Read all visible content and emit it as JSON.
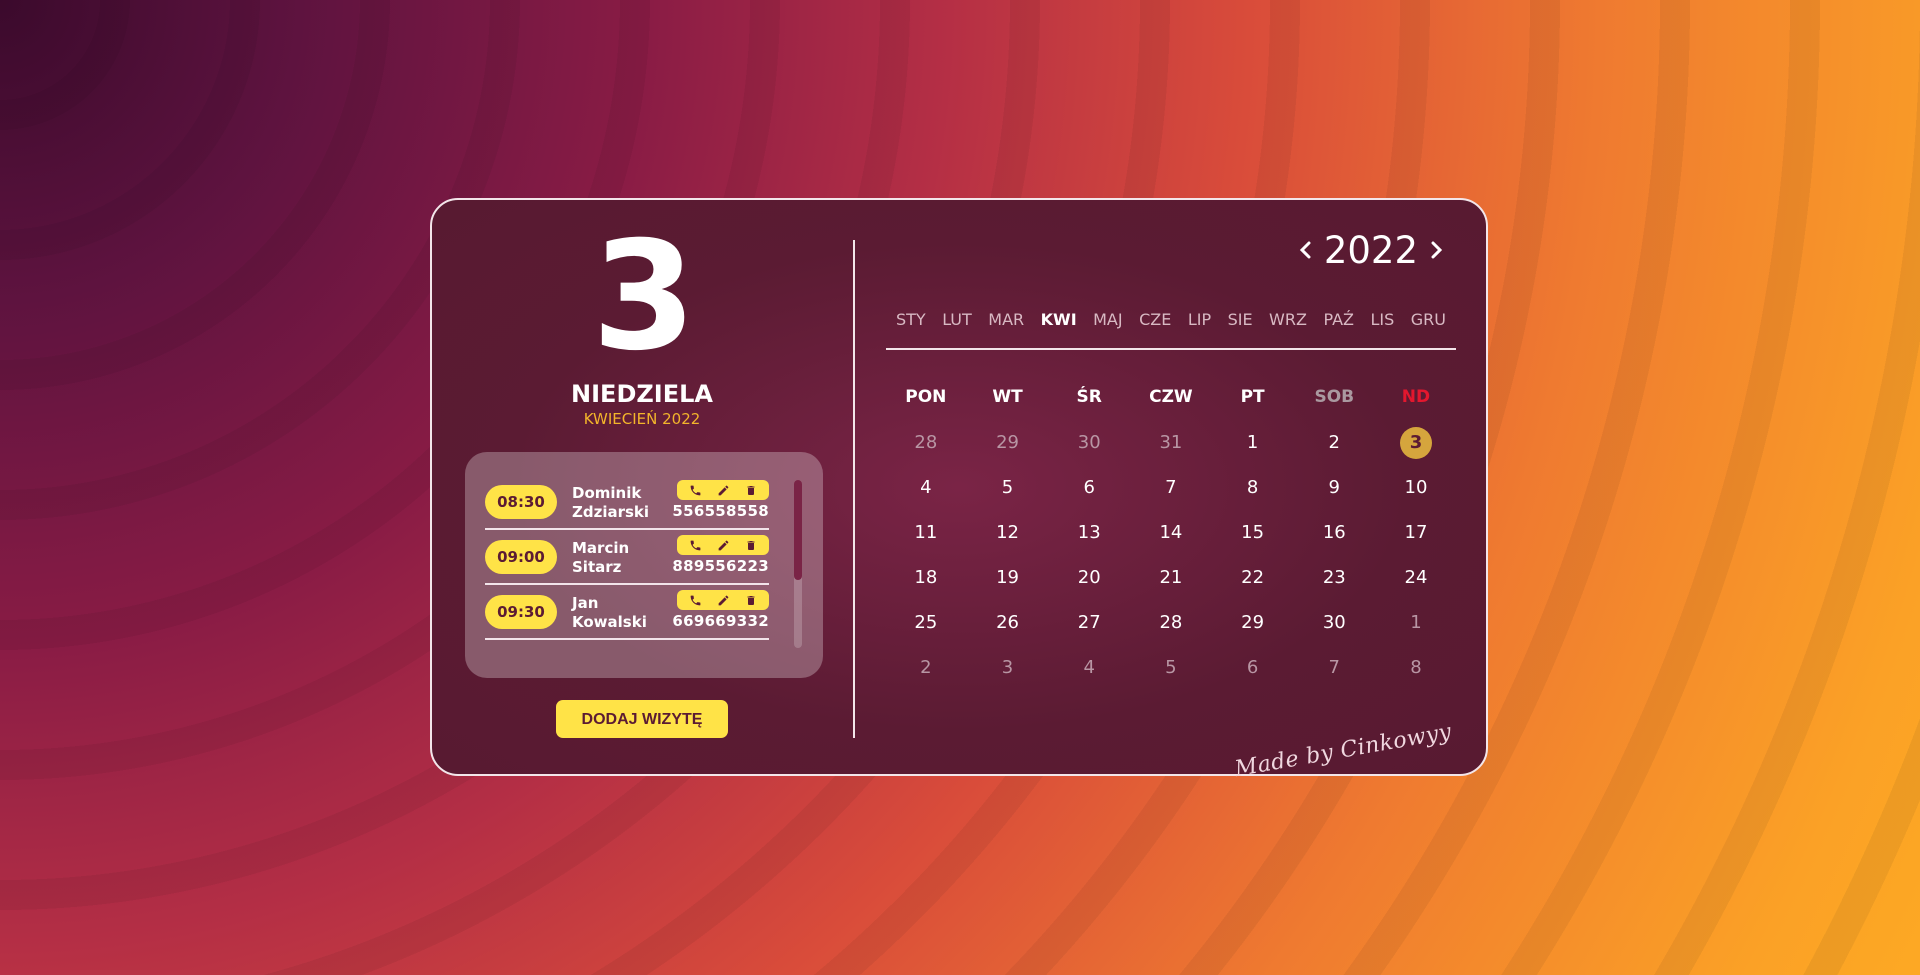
{
  "colors": {
    "accent_yellow": "#ffe347",
    "today_gold": "#d5a53d",
    "sunday_red": "#e3172e",
    "card_bg": "#5b1b33"
  },
  "day_panel": {
    "day_number": "3",
    "weekday": "NIEDZIELA",
    "month_year": "KWIECIEŃ 2022"
  },
  "appointments": [
    {
      "time": "08:30",
      "first_name": "Dominik",
      "last_name": "Zdziarski",
      "phone": "556558558"
    },
    {
      "time": "09:00",
      "first_name": "Marcin",
      "last_name": "Sitarz",
      "phone": "889556223"
    },
    {
      "time": "09:30",
      "first_name": "Jan",
      "last_name": "Kowalski",
      "phone": "669669332"
    }
  ],
  "appointment_icons": [
    "phone-icon",
    "edit-icon",
    "trash-icon"
  ],
  "add_button_label": "DODAJ WIZYTĘ",
  "year_nav": {
    "prev": "<",
    "year": "2022",
    "next": ">"
  },
  "months": [
    "STY",
    "LUT",
    "MAR",
    "KWI",
    "MAJ",
    "CZE",
    "LIP",
    "SIE",
    "WRZ",
    "PAŹ",
    "LIS",
    "GRU"
  ],
  "active_month": "KWI",
  "weekday_headers": [
    "PON",
    "WT",
    "ŚR",
    "CZW",
    "PT",
    "SOB",
    "ND"
  ],
  "calendar_weeks": [
    [
      {
        "d": "28",
        "muted": true
      },
      {
        "d": "29",
        "muted": true
      },
      {
        "d": "30",
        "muted": true
      },
      {
        "d": "31",
        "muted": true
      },
      {
        "d": "1"
      },
      {
        "d": "2"
      },
      {
        "d": "3",
        "today": true
      }
    ],
    [
      {
        "d": "4"
      },
      {
        "d": "5"
      },
      {
        "d": "6"
      },
      {
        "d": "7"
      },
      {
        "d": "8"
      },
      {
        "d": "9"
      },
      {
        "d": "10"
      }
    ],
    [
      {
        "d": "11"
      },
      {
        "d": "12"
      },
      {
        "d": "13"
      },
      {
        "d": "14"
      },
      {
        "d": "15"
      },
      {
        "d": "16"
      },
      {
        "d": "17"
      }
    ],
    [
      {
        "d": "18"
      },
      {
        "d": "19"
      },
      {
        "d": "20"
      },
      {
        "d": "21"
      },
      {
        "d": "22"
      },
      {
        "d": "23"
      },
      {
        "d": "24"
      }
    ],
    [
      {
        "d": "25"
      },
      {
        "d": "26"
      },
      {
        "d": "27"
      },
      {
        "d": "28"
      },
      {
        "d": "29"
      },
      {
        "d": "30"
      },
      {
        "d": "1",
        "muted": true
      }
    ],
    [
      {
        "d": "2",
        "muted": true
      },
      {
        "d": "3",
        "muted": true
      },
      {
        "d": "4",
        "muted": true
      },
      {
        "d": "5",
        "muted": true
      },
      {
        "d": "6",
        "muted": true
      },
      {
        "d": "7",
        "muted": true
      },
      {
        "d": "8",
        "muted": true
      }
    ]
  ],
  "signature": "Made by Cinkowyy"
}
